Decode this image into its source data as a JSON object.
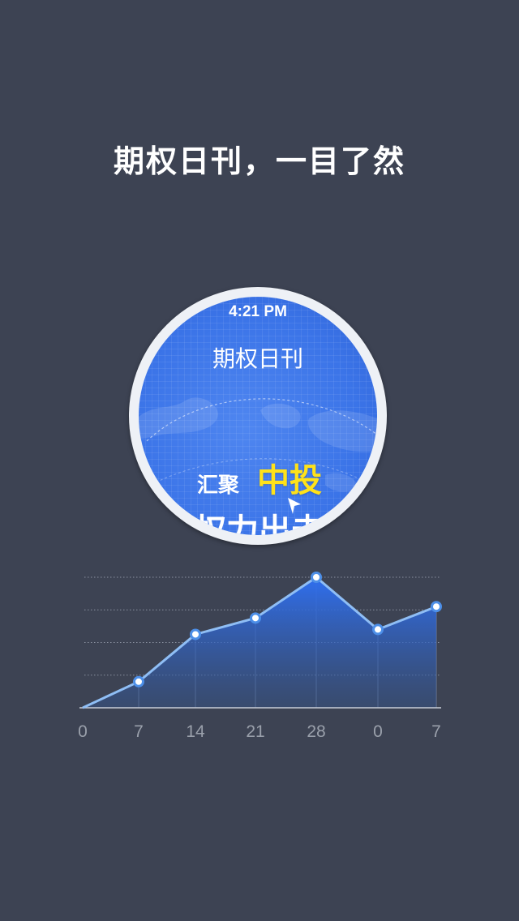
{
  "headline": "期权日刊，一目了然",
  "phone_preview": {
    "status_time": "4:21 PM",
    "app_title": "期权日刊",
    "promo_line1_white": "汇聚",
    "promo_line1_yellow": "中投",
    "promo_line2": "权力出击"
  },
  "colors": {
    "background": "#3d4353",
    "accent_blue": "#3b74e8",
    "highlight_yellow": "#ffe21a",
    "line": "#8fbef5"
  },
  "chart_data": {
    "type": "area",
    "categories": [
      "0",
      "7",
      "14",
      "21",
      "28",
      "0",
      "7"
    ],
    "values": [
      0,
      1.6,
      4.5,
      5.5,
      8.0,
      4.8,
      6.2
    ],
    "ylim": [
      0,
      8
    ],
    "grid": true,
    "title": "",
    "xlabel": "",
    "ylabel": ""
  }
}
